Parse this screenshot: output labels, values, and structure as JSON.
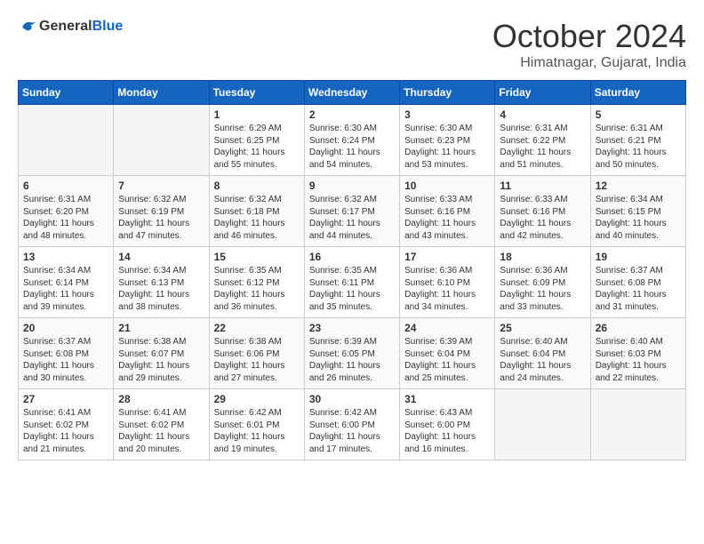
{
  "header": {
    "logo_general": "General",
    "logo_blue": "Blue",
    "month_title": "October 2024",
    "location": "Himatnagar, Gujarat, India"
  },
  "days_of_week": [
    "Sunday",
    "Monday",
    "Tuesday",
    "Wednesday",
    "Thursday",
    "Friday",
    "Saturday"
  ],
  "weeks": [
    [
      {
        "day": null
      },
      {
        "day": null
      },
      {
        "day": 1,
        "sunrise": "6:29 AM",
        "sunset": "6:25 PM",
        "daylight": "11 hours and 55 minutes."
      },
      {
        "day": 2,
        "sunrise": "6:30 AM",
        "sunset": "6:24 PM",
        "daylight": "11 hours and 54 minutes."
      },
      {
        "day": 3,
        "sunrise": "6:30 AM",
        "sunset": "6:23 PM",
        "daylight": "11 hours and 53 minutes."
      },
      {
        "day": 4,
        "sunrise": "6:31 AM",
        "sunset": "6:22 PM",
        "daylight": "11 hours and 51 minutes."
      },
      {
        "day": 5,
        "sunrise": "6:31 AM",
        "sunset": "6:21 PM",
        "daylight": "11 hours and 50 minutes."
      }
    ],
    [
      {
        "day": 6,
        "sunrise": "6:31 AM",
        "sunset": "6:20 PM",
        "daylight": "11 hours and 48 minutes."
      },
      {
        "day": 7,
        "sunrise": "6:32 AM",
        "sunset": "6:19 PM",
        "daylight": "11 hours and 47 minutes."
      },
      {
        "day": 8,
        "sunrise": "6:32 AM",
        "sunset": "6:18 PM",
        "daylight": "11 hours and 46 minutes."
      },
      {
        "day": 9,
        "sunrise": "6:32 AM",
        "sunset": "6:17 PM",
        "daylight": "11 hours and 44 minutes."
      },
      {
        "day": 10,
        "sunrise": "6:33 AM",
        "sunset": "6:16 PM",
        "daylight": "11 hours and 43 minutes."
      },
      {
        "day": 11,
        "sunrise": "6:33 AM",
        "sunset": "6:16 PM",
        "daylight": "11 hours and 42 minutes."
      },
      {
        "day": 12,
        "sunrise": "6:34 AM",
        "sunset": "6:15 PM",
        "daylight": "11 hours and 40 minutes."
      }
    ],
    [
      {
        "day": 13,
        "sunrise": "6:34 AM",
        "sunset": "6:14 PM",
        "daylight": "11 hours and 39 minutes."
      },
      {
        "day": 14,
        "sunrise": "6:34 AM",
        "sunset": "6:13 PM",
        "daylight": "11 hours and 38 minutes."
      },
      {
        "day": 15,
        "sunrise": "6:35 AM",
        "sunset": "6:12 PM",
        "daylight": "11 hours and 36 minutes."
      },
      {
        "day": 16,
        "sunrise": "6:35 AM",
        "sunset": "6:11 PM",
        "daylight": "11 hours and 35 minutes."
      },
      {
        "day": 17,
        "sunrise": "6:36 AM",
        "sunset": "6:10 PM",
        "daylight": "11 hours and 34 minutes."
      },
      {
        "day": 18,
        "sunrise": "6:36 AM",
        "sunset": "6:09 PM",
        "daylight": "11 hours and 33 minutes."
      },
      {
        "day": 19,
        "sunrise": "6:37 AM",
        "sunset": "6:08 PM",
        "daylight": "11 hours and 31 minutes."
      }
    ],
    [
      {
        "day": 20,
        "sunrise": "6:37 AM",
        "sunset": "6:08 PM",
        "daylight": "11 hours and 30 minutes."
      },
      {
        "day": 21,
        "sunrise": "6:38 AM",
        "sunset": "6:07 PM",
        "daylight": "11 hours and 29 minutes."
      },
      {
        "day": 22,
        "sunrise": "6:38 AM",
        "sunset": "6:06 PM",
        "daylight": "11 hours and 27 minutes."
      },
      {
        "day": 23,
        "sunrise": "6:39 AM",
        "sunset": "6:05 PM",
        "daylight": "11 hours and 26 minutes."
      },
      {
        "day": 24,
        "sunrise": "6:39 AM",
        "sunset": "6:04 PM",
        "daylight": "11 hours and 25 minutes."
      },
      {
        "day": 25,
        "sunrise": "6:40 AM",
        "sunset": "6:04 PM",
        "daylight": "11 hours and 24 minutes."
      },
      {
        "day": 26,
        "sunrise": "6:40 AM",
        "sunset": "6:03 PM",
        "daylight": "11 hours and 22 minutes."
      }
    ],
    [
      {
        "day": 27,
        "sunrise": "6:41 AM",
        "sunset": "6:02 PM",
        "daylight": "11 hours and 21 minutes."
      },
      {
        "day": 28,
        "sunrise": "6:41 AM",
        "sunset": "6:02 PM",
        "daylight": "11 hours and 20 minutes."
      },
      {
        "day": 29,
        "sunrise": "6:42 AM",
        "sunset": "6:01 PM",
        "daylight": "11 hours and 19 minutes."
      },
      {
        "day": 30,
        "sunrise": "6:42 AM",
        "sunset": "6:00 PM",
        "daylight": "11 hours and 17 minutes."
      },
      {
        "day": 31,
        "sunrise": "6:43 AM",
        "sunset": "6:00 PM",
        "daylight": "11 hours and 16 minutes."
      },
      {
        "day": null
      },
      {
        "day": null
      }
    ]
  ]
}
